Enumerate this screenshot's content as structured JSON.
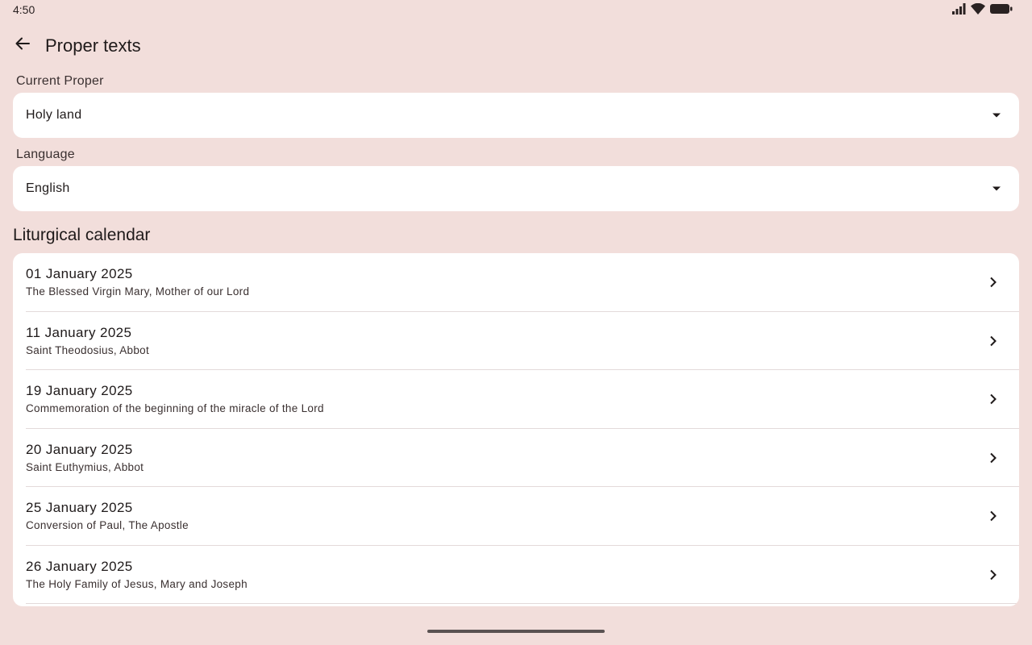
{
  "status": {
    "time": "4:50"
  },
  "header": {
    "title": "Proper texts"
  },
  "proper": {
    "label": "Current Proper",
    "value": "Holy land"
  },
  "language": {
    "label": "Language",
    "value": "English"
  },
  "calendar": {
    "title": "Liturgical calendar",
    "items": [
      {
        "date": "01 January 2025",
        "desc": "The Blessed Virgin Mary, Mother of our Lord"
      },
      {
        "date": "11 January 2025",
        "desc": "Saint Theodosius, Abbot"
      },
      {
        "date": "19 January 2025",
        "desc": "Commemoration of the beginning of the miracle of the Lord"
      },
      {
        "date": "20 January 2025",
        "desc": "Saint Euthymius, Abbot"
      },
      {
        "date": "25 January 2025",
        "desc": "Conversion of Paul, The Apostle"
      },
      {
        "date": "26 January 2025",
        "desc": "The Holy Family of Jesus, Mary and Joseph"
      }
    ]
  }
}
